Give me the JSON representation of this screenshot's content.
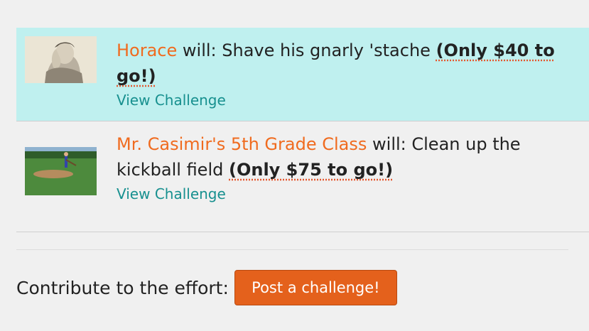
{
  "challenges": [
    {
      "owner": "Horace",
      "verb": "will:",
      "task": "Shave his gnarly 'stache",
      "remaining": "(Only $40 to go!)",
      "link": "View Challenge"
    },
    {
      "owner": "Mr. Casimir's 5th Grade Class",
      "verb": "will:",
      "task": "Clean up the kickball field",
      "remaining": "(Only $75 to go!)",
      "link": "View Challenge"
    }
  ],
  "contribute": {
    "label": "Contribute to the effort:",
    "button": "Post a challenge!"
  },
  "colors": {
    "accent": "#f06b1f",
    "link": "#17908f",
    "highlight": "#bff0ef",
    "button": "#e4611c"
  }
}
